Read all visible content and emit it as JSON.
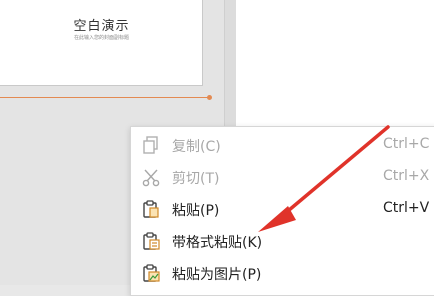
{
  "slide": {
    "title": "空白演示",
    "subtitle": "在此输入您的封面副标题"
  },
  "context_menu": {
    "items": [
      {
        "label": "复制(C)",
        "shortcut": "Ctrl+C",
        "icon": "copy-icon",
        "enabled": false
      },
      {
        "label": "剪切(T)",
        "shortcut": "Ctrl+X",
        "icon": "scissors-icon",
        "enabled": false
      },
      {
        "label": "粘贴(P)",
        "shortcut": "Ctrl+V",
        "icon": "paste-icon",
        "enabled": true
      },
      {
        "label": "带格式粘贴(K)",
        "shortcut": "",
        "icon": "paste-formatted-icon",
        "enabled": true
      },
      {
        "label": "粘贴为图片(P)",
        "shortcut": "",
        "icon": "paste-as-picture-icon",
        "enabled": true
      }
    ]
  },
  "colors": {
    "accent": "#e38a52",
    "annotation_arrow": "#e0332a"
  }
}
